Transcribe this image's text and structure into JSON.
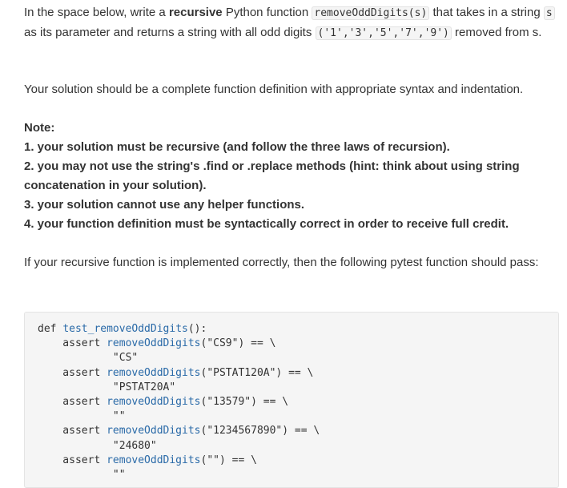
{
  "intro": {
    "prefix": "In the space below, write a ",
    "bold": "recursive",
    "mid1": " Python function ",
    "func_sig": "removeOddDigits(s)",
    "mid2": " that takes in a string ",
    "param": "s",
    "mid3": " as its parameter and returns a string with all odd digits ",
    "digits": "('1','3','5','7','9')",
    "suffix": " removed from s."
  },
  "solution_text": "Your solution should be a complete function definition with appropriate syntax and indentation.",
  "note": {
    "heading": "Note:",
    "items": [
      "1. your solution must be recursive (and follow the three laws of recursion).",
      "2. you may not use the string's .find or .replace methods (hint: think about using string concatenation in your solution).",
      "3. your solution cannot use any helper functions.",
      "4. your function definition must be syntactically correct in order to receive full credit."
    ]
  },
  "pytest_text": "If your recursive function is implemented correctly, then the following pytest function should pass:",
  "code": {
    "def_kw": "def ",
    "def_name": "test_removeOddDigits",
    "def_tail": "():",
    "asserts": [
      {
        "kw": "    assert ",
        "call": "removeOddDigits",
        "arg": "(\"CS9\") == \\",
        "expected": "            \"CS\""
      },
      {
        "kw": "    assert ",
        "call": "removeOddDigits",
        "arg": "(\"PSTAT120A\") == \\",
        "expected": "            \"PSTAT20A\""
      },
      {
        "kw": "    assert ",
        "call": "removeOddDigits",
        "arg": "(\"13579\") == \\",
        "expected": "            \"\""
      },
      {
        "kw": "    assert ",
        "call": "removeOddDigits",
        "arg": "(\"1234567890\") == \\",
        "expected": "            \"24680\""
      },
      {
        "kw": "    assert ",
        "call": "removeOddDigits",
        "arg": "(\"\") == \\",
        "expected": "            \"\""
      }
    ]
  }
}
